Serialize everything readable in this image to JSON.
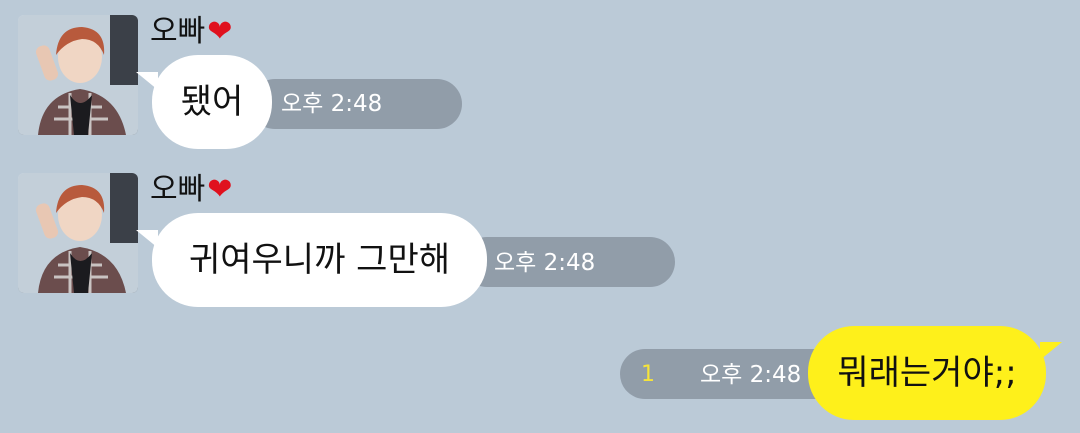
{
  "messages": [
    {
      "sender": "오빠",
      "heart": "❤",
      "text": "됐어",
      "time": "오후 2:48"
    },
    {
      "sender": "오빠",
      "heart": "❤",
      "text": "귀여우니까 그만해",
      "time": "오후 2:48"
    },
    {
      "text": "뭐래는거야;;",
      "time": "오후 2:48",
      "unread": "1"
    }
  ],
  "colors": {
    "background": "#bbcad7",
    "incoming_bubble": "#ffffff",
    "outgoing_bubble": "#fef01b",
    "time_pill": "#8e9aa6",
    "unread_count": "#f6e43a",
    "heart": "#e0111e"
  },
  "icons": {
    "heart": "heart-emoji"
  }
}
